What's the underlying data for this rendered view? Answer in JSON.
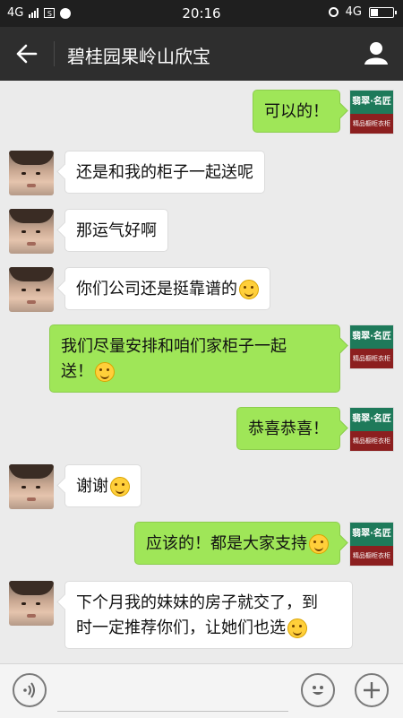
{
  "status_bar": {
    "network_left": "4G",
    "time": "20:16",
    "network_right": "4G"
  },
  "header": {
    "title": "碧桂园果岭山欣宝"
  },
  "avatars": {
    "vendor_top": "翡翠·名匠",
    "vendor_bottom": "精品橱柜衣柜之家"
  },
  "messages": [
    {
      "side": "right",
      "text": "可以的！",
      "emoji": false
    },
    {
      "side": "left",
      "text": "还是和我的柜子一起送呢",
      "emoji": false
    },
    {
      "side": "left",
      "text": "那运气好啊",
      "emoji": false
    },
    {
      "side": "left",
      "text": "你们公司还是挺靠谱的",
      "emoji": true
    },
    {
      "side": "right",
      "text_line1": "我们尽量安排和咱们家柜子一起",
      "text_line2": "送！",
      "emoji": true
    },
    {
      "side": "right",
      "text": "恭喜恭喜！",
      "emoji": false
    },
    {
      "side": "left",
      "text": "谢谢",
      "emoji": true
    },
    {
      "side": "right",
      "text": "应该的！都是大家支持",
      "emoji": true
    },
    {
      "side": "left",
      "text_line1": "下个月我的妹妹的房子就交了，到",
      "text_line2": "时一定推荐你们，让她们也选",
      "emoji": true
    }
  ],
  "icons": {
    "back": "back-arrow-icon",
    "profile": "person-icon",
    "voice": "voice-icon",
    "emoji": "emoji-icon",
    "plus": "plus-icon"
  },
  "colors": {
    "sent_bubble": "#9fe658",
    "received_bubble": "#ffffff",
    "title_bar": "#2e2e2e",
    "status_bar": "#1f1f1f"
  }
}
